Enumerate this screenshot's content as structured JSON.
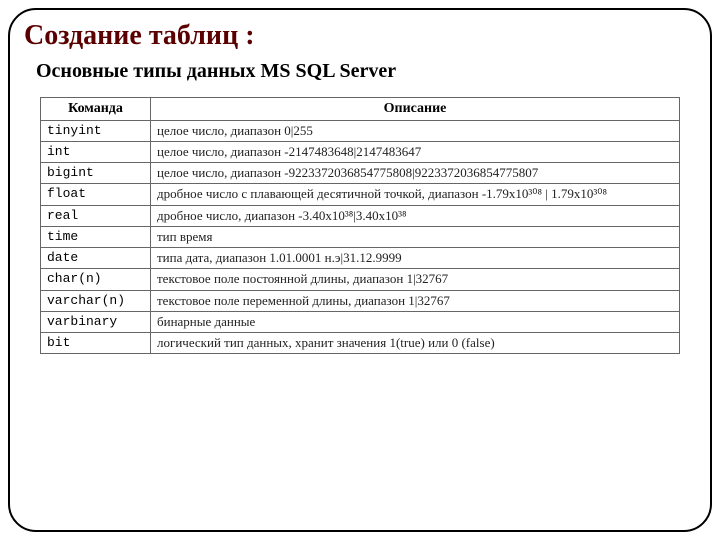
{
  "title": "Создание таблиц :",
  "subtitle": "Основные типы данных MS SQL Server",
  "table": {
    "headers": {
      "cmd": "Команда",
      "desc": "Описание"
    },
    "rows": [
      {
        "cmd": "tinyint",
        "desc": "целое число, диапазон 0|255"
      },
      {
        "cmd": "int",
        "desc": "целое число, диапазон -2147483648|2147483647"
      },
      {
        "cmd": "bigint",
        "desc": "целое число, диапазон -9223372036854775808|9223372036854775807"
      },
      {
        "cmd": "float",
        "desc": "дробное число с плавающей десятичной точкой, диапазон -1.79x10³⁰⁸ | 1.79x10³⁰⁸"
      },
      {
        "cmd": "real",
        "desc": "дробное число, диапазон -3.40x10³⁸|3.40x10³⁸"
      },
      {
        "cmd": "time",
        "desc": "тип время"
      },
      {
        "cmd": "date",
        "desc": "типа дата, диапазон 1.01.0001 н.э|31.12.9999"
      },
      {
        "cmd": "char(n)",
        "desc": "текстовое поле постоянной длины, диапазон 1|32767"
      },
      {
        "cmd": "varchar(n)",
        "desc": "текстовое поле переменной длины, диапазон 1|32767"
      },
      {
        "cmd": "varbinary",
        "desc": "бинарные данные"
      },
      {
        "cmd": "bit",
        "desc": "логический тип данных, хранит значения 1(true) или 0 (false)"
      }
    ]
  }
}
